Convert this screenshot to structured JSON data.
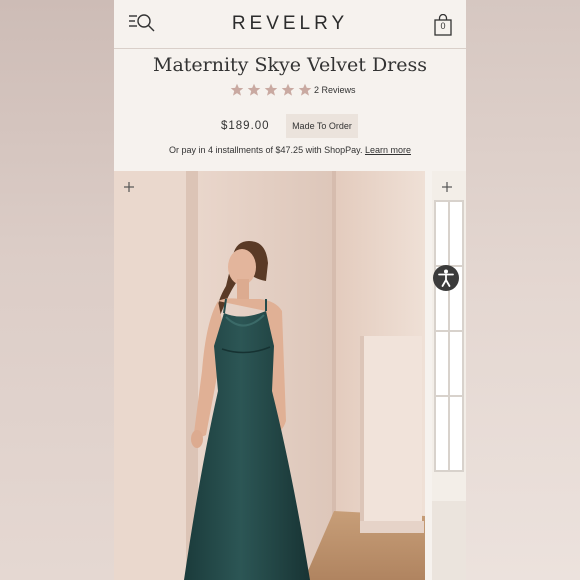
{
  "header": {
    "logo": "REVELRY",
    "bag_count": "0",
    "menu_icon": "menu-search-icon",
    "bag_icon": "shopping-bag-icon"
  },
  "product": {
    "title": "Maternity Skye Velvet Dress",
    "rating": 5,
    "rating_max": 5,
    "reviews_label": "2 Reviews",
    "price": "$189.00",
    "order_badge": "Made To Order",
    "shoppay_text": "Or pay in 4 installments of $47.25 with ShopPay.",
    "shoppay_link": "Learn more"
  },
  "gallery": {
    "plus_icon": "zoom-plus-icon",
    "accessibility_icon": "accessibility-icon"
  },
  "colors": {
    "page_bg": "#f6f2ee",
    "star": "#c9a9a1",
    "dress": "#244b4b",
    "badge_bg": "#ebe3dc",
    "accessibility_button": "#3b3b3b"
  }
}
